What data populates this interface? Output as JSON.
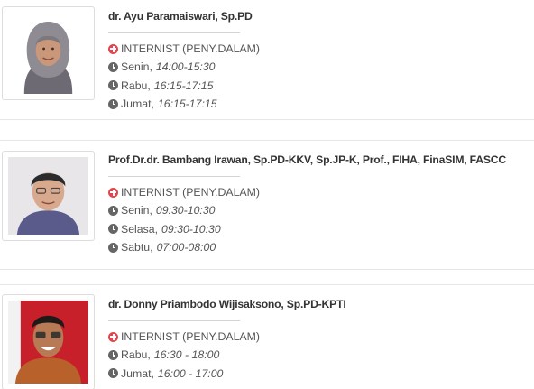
{
  "doctors": [
    {
      "name": "dr. Ayu Paramaiswari, Sp.PD",
      "specialty": "INTERNIST (PENY.DALAM)",
      "schedule": [
        {
          "day": "Senin,",
          "time": "14:00-15:30"
        },
        {
          "day": "Rabu,",
          "time": "16:15-17:15"
        },
        {
          "day": "Jumat,",
          "time": "16:15-17:15"
        }
      ]
    },
    {
      "name": "Prof.Dr.dr. Bambang Irawan, Sp.PD-KKV, Sp.JP-K, Prof., FIHA, FinaSIM, FASCC",
      "specialty": "INTERNIST (PENY.DALAM)",
      "schedule": [
        {
          "day": "Senin,",
          "time": "09:30-10:30"
        },
        {
          "day": "Selasa,",
          "time": "09:30-10:30"
        },
        {
          "day": "Sabtu,",
          "time": "07:00-08:00"
        }
      ]
    },
    {
      "name": "dr. Donny Priambodo Wijisaksono, Sp.PD-KPTI",
      "specialty": "INTERNIST (PENY.DALAM)",
      "schedule": [
        {
          "day": "Rabu,",
          "time": "16:30 - 18:00"
        },
        {
          "day": "Jumat,",
          "time": "16:00 - 17:00"
        }
      ]
    }
  ],
  "icons": {
    "specialty": "plus-circle-icon",
    "schedule": "clock-icon"
  },
  "colors": {
    "specialty_icon": "#e0474c",
    "clock_icon": "#666666"
  }
}
